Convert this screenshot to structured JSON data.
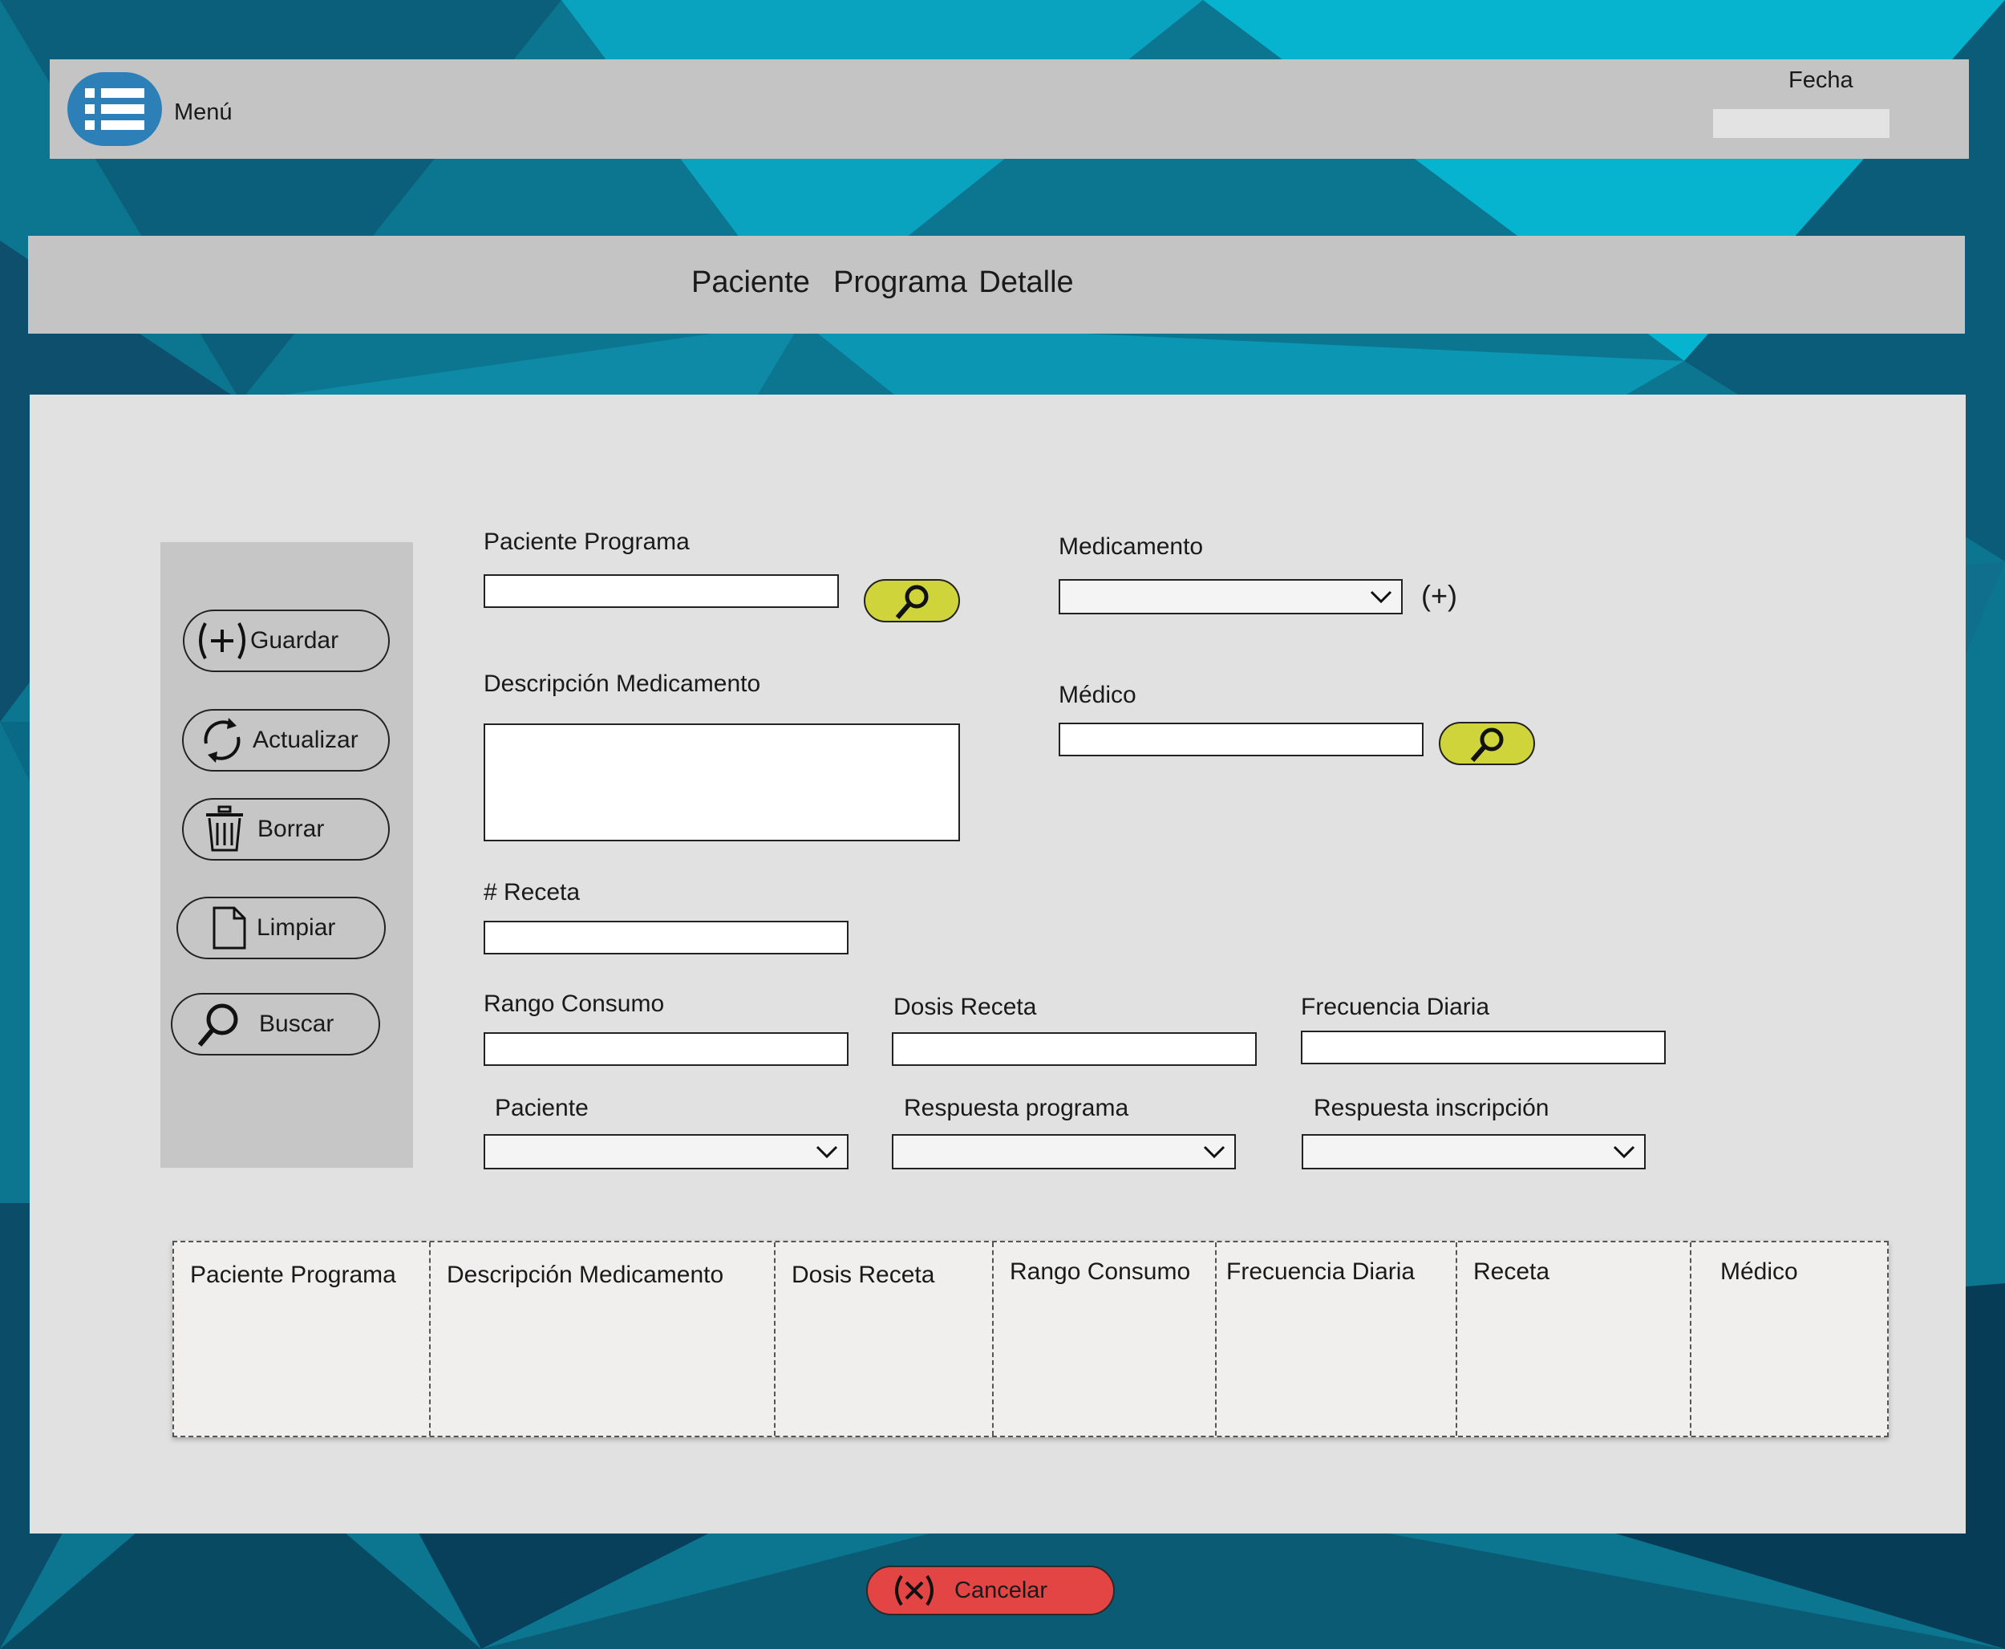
{
  "header": {
    "menu_label": "Menú",
    "date_label": "Fecha",
    "date_value": ""
  },
  "title": "Paciente  Programa Detalle",
  "actions": {
    "guardar": "Guardar",
    "actualizar": "Actualizar",
    "borrar": "Borrar",
    "limpiar": "Limpiar",
    "buscar": "Buscar"
  },
  "form": {
    "paciente_programa_label": "Paciente Programa",
    "medicamento_label": "Medicamento",
    "add_symbol": "(+)",
    "descripcion_label": "Descripción Medicamento",
    "medico_label": "Médico",
    "receta_label": "# Receta",
    "rango_label": "Rango Consumo",
    "dosis_label": "Dosis Receta",
    "frecuencia_label": "Frecuencia Diaria",
    "paciente_label": "Paciente",
    "respuesta_programa_label": "Respuesta programa",
    "respuesta_inscripcion_label": "Respuesta inscripción"
  },
  "table": {
    "columns": [
      "Paciente Programa",
      "Descripción Medicamento",
      "Dosis Receta",
      "Rango Consumo",
      "Frecuencia Diaria",
      "Receta",
      "Médico"
    ]
  },
  "cancel_label": "Cancelar",
  "colors": {
    "accent_search": "#cfd43b",
    "cancel": "#e34545",
    "menu": "#2d7fb8",
    "background": "#0a6f8a"
  }
}
